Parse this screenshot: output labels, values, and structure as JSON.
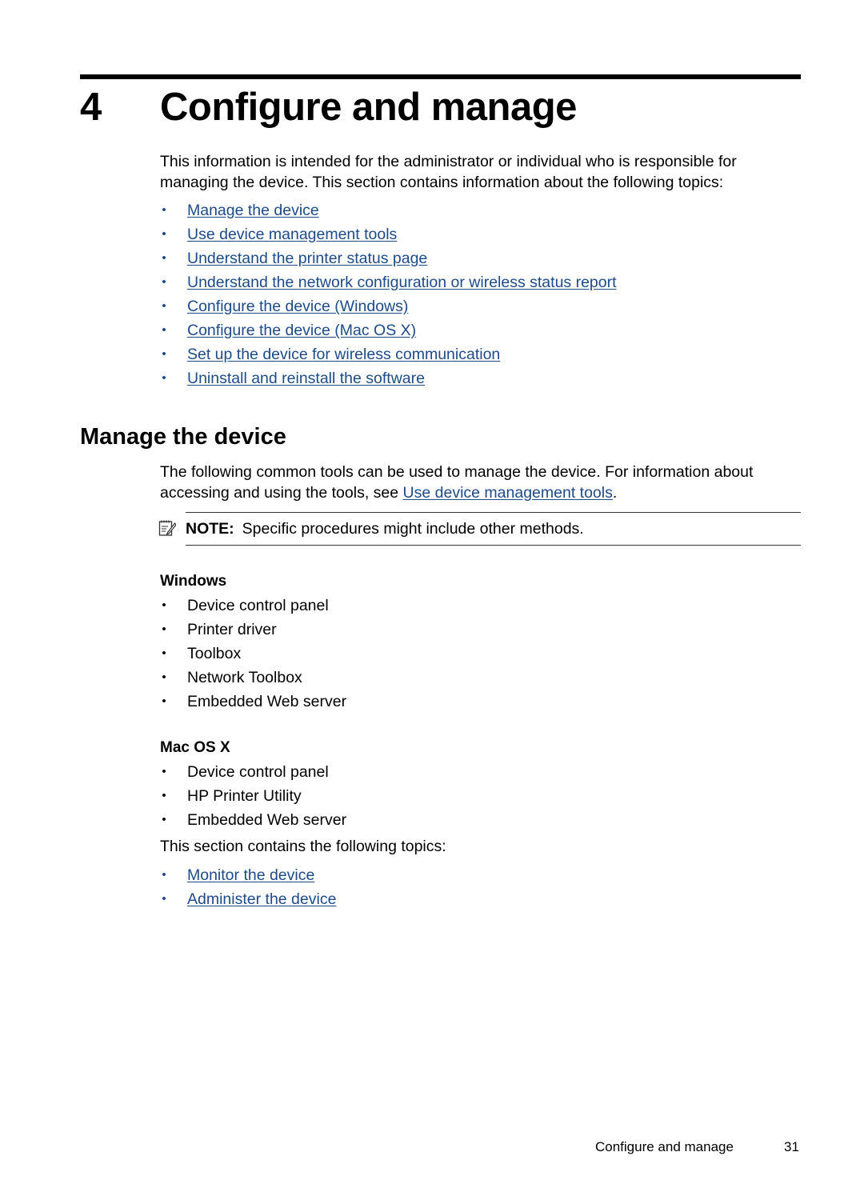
{
  "chapter": {
    "number": "4",
    "title": "Configure and manage",
    "intro": "This information is intended for the administrator or individual who is responsible for managing the device. This section contains information about the following topics:",
    "topics": [
      "Manage the device",
      "Use device management tools",
      "Understand the printer status page",
      "Understand the network configuration or wireless status report",
      "Configure the device (Windows)",
      "Configure the device (Mac OS X)",
      "Set up the device for wireless communication",
      "Uninstall and reinstall the software"
    ]
  },
  "section": {
    "title": "Manage the device",
    "intro_before": "The following common tools can be used to manage the device. For information about accessing and using the tools, see ",
    "intro_link": "Use device management tools",
    "intro_after": ".",
    "note": {
      "icon": "note-pencil-icon",
      "label": "NOTE:",
      "text": "Specific procedures might include other methods."
    },
    "windows": {
      "heading": "Windows",
      "items": [
        "Device control panel",
        "Printer driver",
        "Toolbox",
        "Network Toolbox",
        "Embedded Web server"
      ]
    },
    "mac": {
      "heading": "Mac OS X",
      "items": [
        "Device control panel",
        "HP Printer Utility",
        "Embedded Web server"
      ]
    },
    "topics_intro": "This section contains the following topics:",
    "topics": [
      "Monitor the device",
      "Administer the device"
    ]
  },
  "footer": {
    "title": "Configure and manage",
    "page": "31"
  },
  "colors": {
    "link": "#1c4a8a"
  }
}
